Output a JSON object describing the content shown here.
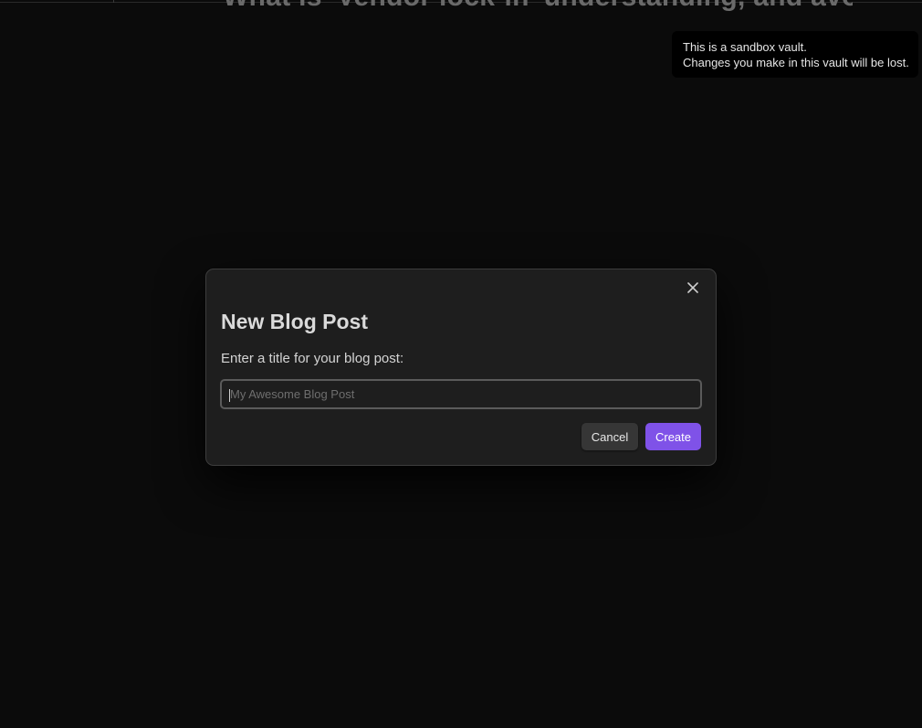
{
  "background": {
    "heading_fragment": "What is 'Vendor lock-in' understanding, and avoiding"
  },
  "notice": {
    "line1": "This is a sandbox vault.",
    "line2": "Changes you make in this vault will be lost."
  },
  "modal": {
    "title": "New Blog Post",
    "prompt": "Enter a title for your blog post:",
    "input_value": "",
    "input_placeholder": "My Awesome Blog Post",
    "cancel_label": "Cancel",
    "create_label": "Create",
    "close_icon": "close-icon"
  },
  "colors": {
    "accent": "#7f52e8",
    "modal_bg": "#1e1e1e",
    "page_bg": "#0b0b0b"
  }
}
